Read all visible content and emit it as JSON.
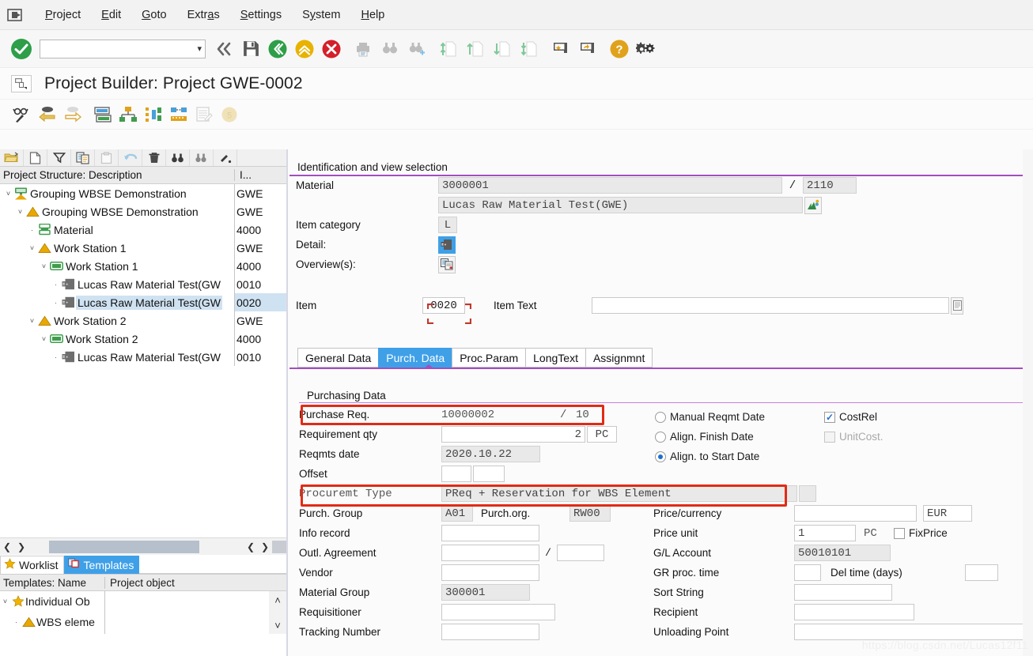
{
  "menu": {
    "system_icon": "sap-system-icon",
    "items": [
      {
        "label": "Project",
        "accel": "P"
      },
      {
        "label": "Edit",
        "accel": "E"
      },
      {
        "label": "Goto",
        "accel": "G"
      },
      {
        "label": "Extras",
        "accel": "a"
      },
      {
        "label": "Settings",
        "accel": "S"
      },
      {
        "label": "System",
        "accel": "y"
      },
      {
        "label": "Help",
        "accel": "H"
      }
    ]
  },
  "toolbar": {
    "command_field_value": "",
    "command_field_placeholder": "",
    "icons": [
      "enter-ok-icon",
      "collapse-left-icon",
      "save-icon",
      "back-icon",
      "exit-up-icon",
      "cancel-icon",
      "print-icon",
      "find-icon",
      "find-next-icon",
      "first-page-icon",
      "previous-page-icon",
      "next-page-icon",
      "last-page-icon",
      "create-shortcut-icon",
      "new-session-icon",
      "help-icon",
      "customize-icon"
    ]
  },
  "title": {
    "icon": "project-builder-icon",
    "text": "Project Builder: Project GWE-0002"
  },
  "app_toolbar": {
    "icons": [
      "glasses-pen-icon",
      "previous-object-icon",
      "next-object-icon",
      "detail-list-icon",
      "hierarchy-graphic-icon",
      "gantt-chart-icon",
      "network-graphic-icon",
      "report-icon",
      "disabled-badge-icon"
    ]
  },
  "tree": {
    "toolbar_icons": [
      "open-folder-icon",
      "new-document-icon",
      "filter-icon",
      "copy-icon",
      "paste-icon",
      "undo-icon",
      "delete-icon",
      "find-icon",
      "find-next-icon",
      "more-icon"
    ],
    "columns": [
      "Project Structure: Description",
      "I..."
    ],
    "rows": [
      {
        "indent": 0,
        "twist": "˅",
        "icon": "project-definition-icon",
        "label": "Grouping WBSE Demonstration",
        "id": "GWE",
        "selected": false
      },
      {
        "indent": 1,
        "twist": "˅",
        "icon": "wbs-element-icon",
        "label": "Grouping WBSE Demonstration",
        "id": "GWE",
        "selected": false
      },
      {
        "indent": 2,
        "twist": "·",
        "icon": "material-icon",
        "label": "Material",
        "id": "4000",
        "selected": false
      },
      {
        "indent": 2,
        "twist": "˅",
        "icon": "wbs-element-icon",
        "label": "Work Station 1",
        "id": "GWE",
        "selected": false
      },
      {
        "indent": 3,
        "twist": "˅",
        "icon": "activity-icon",
        "label": "Work Station 1",
        "id": "4000",
        "selected": false
      },
      {
        "indent": 4,
        "twist": "·",
        "icon": "component-icon",
        "label": "Lucas Raw Material Test(GW",
        "id": "0010",
        "selected": false
      },
      {
        "indent": 4,
        "twist": "·",
        "icon": "component-icon",
        "label": "Lucas Raw Material Test(GW",
        "id": "0020",
        "selected": true
      },
      {
        "indent": 2,
        "twist": "˅",
        "icon": "wbs-element-icon",
        "label": "Work Station 2",
        "id": "GWE",
        "selected": false
      },
      {
        "indent": 3,
        "twist": "˅",
        "icon": "activity-icon",
        "label": "Work Station 2",
        "id": "4000",
        "selected": false
      },
      {
        "indent": 4,
        "twist": "·",
        "icon": "component-icon",
        "label": "Lucas Raw Material Test(GW",
        "id": "0010",
        "selected": false
      }
    ],
    "scroll_label": "··"
  },
  "worklist": {
    "tabs": [
      {
        "label": "Worklist",
        "icon": "star-icon",
        "active": false
      },
      {
        "label": "Templates",
        "icon": "templates-icon",
        "active": true
      }
    ],
    "columns": [
      "Templates: Name",
      "Project object",
      ""
    ],
    "rows": [
      {
        "indent": 0,
        "twist": "˅",
        "icon": "star-icon",
        "label": "Individual Ob",
        "object": ""
      },
      {
        "indent": 1,
        "twist": "·",
        "icon": "wbs-element-icon",
        "label": "WBS eleme",
        "object": ""
      }
    ],
    "scroll_up": "˄",
    "scroll_down": "˅"
  },
  "identification": {
    "section_title": "Identification and view selection",
    "material_label": "Material",
    "material_value": "3000001",
    "material_separator": "/",
    "plant_value": "2110",
    "material_desc": "Lucas Raw Material Test(GWE)",
    "material_desc_icon": "display-material-icon",
    "item_category_label": "Item category",
    "item_category_value": "L",
    "detail_label": "Detail:",
    "detail_icon": "component-detail-icon",
    "overview_label": "Overview(s):",
    "overview_icon": "overview-icon"
  },
  "item": {
    "label": "Item",
    "value": "0020",
    "text_label": "Item Text",
    "text_value": "",
    "text_expand_icon": "long-text-icon"
  },
  "tabs": [
    {
      "label": "General Data",
      "active": false
    },
    {
      "label": "Purch. Data",
      "active": true
    },
    {
      "label": "Proc.Param",
      "active": false
    },
    {
      "label": "LongText",
      "active": false
    },
    {
      "label": "Assignmnt",
      "active": false
    }
  ],
  "purchasing": {
    "section_title": "Purchasing Data",
    "left_fields": [
      {
        "label": "Purchase Req.",
        "value": "10000002",
        "sep": "/",
        "value2": "10",
        "style": "flat"
      },
      {
        "label": "Requirement qty",
        "value": "2",
        "unit": "PC",
        "style": "qty"
      },
      {
        "label": "Reqmts date",
        "value": "2020.10.22",
        "style": "gray"
      },
      {
        "label": "Offset",
        "value": "",
        "value2": "",
        "style": "offset"
      },
      {
        "label": "Procuremt Type",
        "value": "PReq + Reservation for WBS Element",
        "style": "procurement"
      },
      {
        "label": "Purch. Group",
        "value": "A01",
        "label2": "Purch.org.",
        "value2": "RW00",
        "style": "pair"
      },
      {
        "label": "Info record",
        "value": "",
        "style": "white"
      },
      {
        "label": "Outl. Agreement",
        "value": "",
        "sep": "/",
        "value2": "",
        "style": "split"
      },
      {
        "label": "Vendor",
        "value": "",
        "style": "white"
      },
      {
        "label": "Material Group",
        "value": "300001",
        "style": "gray"
      },
      {
        "label": "Requisitioner",
        "value": "",
        "style": "white-wide"
      },
      {
        "label": "Tracking Number",
        "value": "",
        "style": "white"
      }
    ],
    "radio_group": [
      {
        "label": "Manual Reqmt Date",
        "checked": false
      },
      {
        "label": "Align. Finish Date",
        "checked": false
      },
      {
        "label": "Align. to Start Date",
        "checked": true
      }
    ],
    "checkboxes": [
      {
        "label": "CostRel",
        "checked": true,
        "disabled": false
      },
      {
        "label": "UnitCost.",
        "checked": false,
        "disabled": true
      }
    ],
    "right_fields": [
      {
        "label": "Price/currency",
        "value": "",
        "unit": "EUR",
        "style": "currency"
      },
      {
        "label": "Price unit",
        "value": "1",
        "unit": "PC",
        "check_label": "FixPrice",
        "checked": false,
        "style": "priceunit"
      },
      {
        "label": "G/L Account",
        "value": "50010101",
        "style": "gray"
      },
      {
        "label": "GR proc. time",
        "value": "",
        "label2": "Del time (days)",
        "value2": "",
        "style": "pair2"
      },
      {
        "label": "Sort String",
        "value": "",
        "style": "white"
      },
      {
        "label": "Recipient",
        "value": "",
        "style": "white-wide"
      },
      {
        "label": "Unloading Point",
        "value": "",
        "style": "white-xwide"
      }
    ]
  },
  "annotations": {
    "highlight_color": "#e02b16",
    "accent_color": "#a24ec0",
    "selection_color": "#3fa0e8"
  },
  "watermark": "https://blog.csdn.net/Lucas12f11"
}
